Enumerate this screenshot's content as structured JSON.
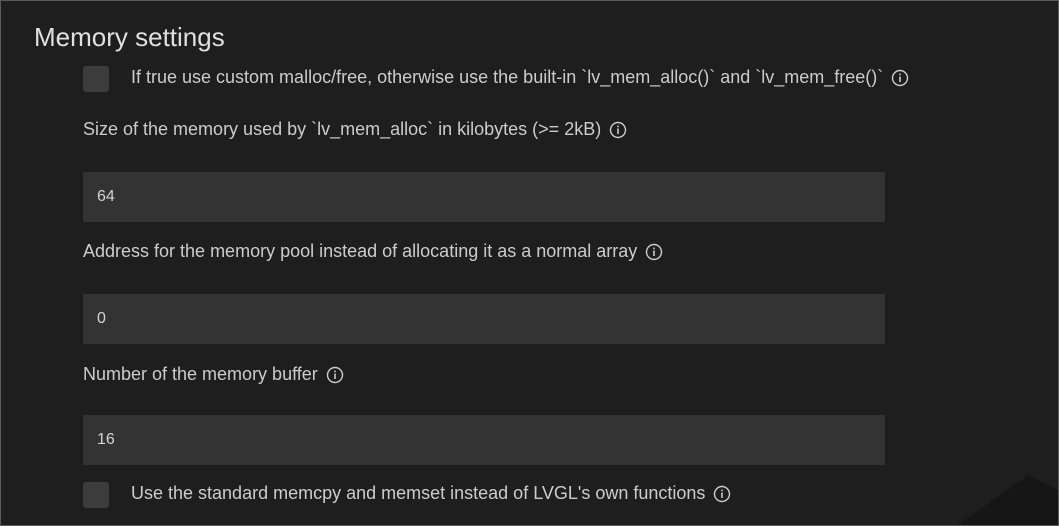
{
  "section": {
    "title": "Memory settings"
  },
  "custom_malloc": {
    "label": "If true use custom malloc/free, otherwise use the built-in `lv_mem_alloc()` and `lv_mem_free()`",
    "checked": false,
    "icon": "info-icon"
  },
  "mem_size": {
    "label": "Size of the memory used by `lv_mem_alloc` in kilobytes (>= 2kB)",
    "value": "64",
    "icon": "info-icon"
  },
  "mem_address": {
    "label": "Address for the memory pool instead of allocating it as a normal array",
    "value": "0",
    "icon": "info-icon"
  },
  "mem_buffer": {
    "label": "Number of the memory buffer",
    "value": "16",
    "icon": "info-icon"
  },
  "std_memcpy": {
    "label": "Use the standard memcpy and memset instead of LVGL's own functions",
    "checked": false,
    "icon": "info-icon"
  },
  "colors": {
    "background": "#1e1e1e",
    "input_background": "#333333",
    "checkbox_background": "#3c3c3c",
    "text": "#cccccc",
    "title": "#e0e0e0"
  }
}
